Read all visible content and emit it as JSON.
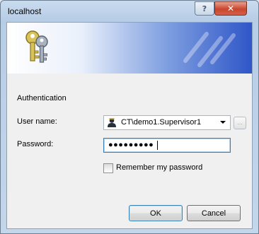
{
  "window": {
    "title": "localhost"
  },
  "titlebar": {
    "help_glyph": "?",
    "close_glyph": "✕"
  },
  "auth": {
    "section_label": "Authentication",
    "username_label": "User name:",
    "username_value": "CT\\demo1.Supervisor1",
    "password_label": "Password:",
    "password_masked": "●●●●●●●●●",
    "browse_label": "...",
    "remember_label": "Remember my password",
    "remember_checked": false
  },
  "buttons": {
    "ok": "OK",
    "cancel": "Cancel"
  },
  "icons": {
    "banner": "keys-icon",
    "user": "user-icon",
    "banner_decoration": "cti-logo-icon"
  }
}
